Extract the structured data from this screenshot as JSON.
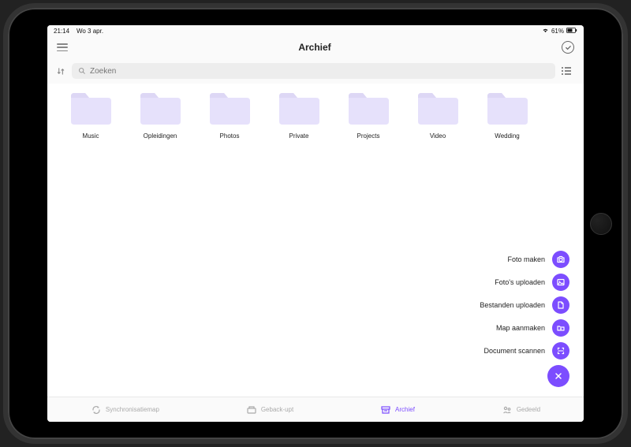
{
  "status": {
    "time": "21:14",
    "date": "Wo 3 apr.",
    "battery": "61%"
  },
  "nav": {
    "title": "Archief"
  },
  "search": {
    "placeholder": "Zoeken"
  },
  "folders": [
    {
      "name": "Music"
    },
    {
      "name": "Opleidingen"
    },
    {
      "name": "Photos"
    },
    {
      "name": "Private"
    },
    {
      "name": "Projects"
    },
    {
      "name": "Video"
    },
    {
      "name": "Wedding"
    }
  ],
  "fab": {
    "items": [
      {
        "label": "Foto maken",
        "icon": "camera"
      },
      {
        "label": "Foto's uploaden",
        "icon": "image"
      },
      {
        "label": "Bestanden uploaden",
        "icon": "file"
      },
      {
        "label": "Map aanmaken",
        "icon": "folder-plus"
      },
      {
        "label": "Document scannen",
        "icon": "scan"
      }
    ]
  },
  "tabs": [
    {
      "label": "Synchronisatiemap",
      "icon": "sync"
    },
    {
      "label": "Geback-upt",
      "icon": "backup"
    },
    {
      "label": "Archief",
      "icon": "archive",
      "active": true
    },
    {
      "label": "Gedeeld",
      "icon": "shared"
    }
  ],
  "colors": {
    "accent": "#7c4dff",
    "folder": "#e6e1fb"
  }
}
